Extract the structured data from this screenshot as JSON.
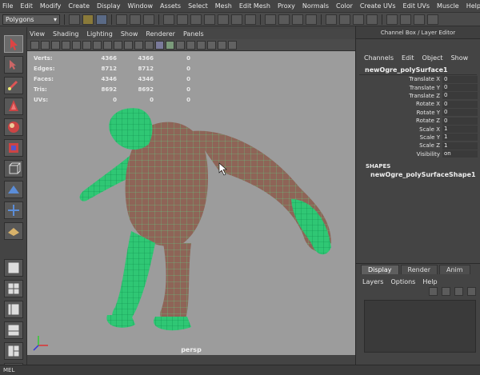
{
  "menubar": [
    "File",
    "Edit",
    "Modify",
    "Create",
    "Display",
    "Window",
    "Assets",
    "Select",
    "Mesh",
    "Edit Mesh",
    "Proxy",
    "Normals",
    "Color",
    "Create UVs",
    "Edit UVs",
    "Muscle",
    "Help"
  ],
  "mode_selector": {
    "value": "Polygons"
  },
  "viewport": {
    "menu": [
      "View",
      "Shading",
      "Lighting",
      "Show",
      "Renderer",
      "Panels"
    ],
    "camera": "persp",
    "stats": [
      {
        "label": "Verts:",
        "v1": "4366",
        "v2": "4366",
        "v3": "0"
      },
      {
        "label": "Edges:",
        "v1": "8712",
        "v2": "8712",
        "v3": "0"
      },
      {
        "label": "Faces:",
        "v1": "4346",
        "v2": "4346",
        "v3": "0"
      },
      {
        "label": "Tris:",
        "v1": "8692",
        "v2": "8692",
        "v3": "0"
      },
      {
        "label": "UVs:",
        "v1": "0",
        "v2": "0",
        "v3": "0"
      }
    ],
    "mesh_color": "#57e08a",
    "skin_color": "#8e6457",
    "background": "#9c9c9c"
  },
  "channel_box": {
    "title": "Channel Box / Layer Editor",
    "menu": [
      "Channels",
      "Edit",
      "Object",
      "Show"
    ],
    "object": "newOgre_polySurface1",
    "attributes": [
      {
        "name": "Translate X",
        "value": "0"
      },
      {
        "name": "Translate Y",
        "value": "0"
      },
      {
        "name": "Translate Z",
        "value": "0"
      },
      {
        "name": "Rotate X",
        "value": "0"
      },
      {
        "name": "Rotate Y",
        "value": "0"
      },
      {
        "name": "Rotate Z",
        "value": "0"
      },
      {
        "name": "Scale X",
        "value": "1"
      },
      {
        "name": "Scale Y",
        "value": "1"
      },
      {
        "name": "Scale Z",
        "value": "1"
      },
      {
        "name": "Visibility",
        "value": "on"
      }
    ],
    "shapes_header": "SHAPES",
    "shape": "newOgre_polySurfaceShape1"
  },
  "layer_editor": {
    "tabs": [
      "Display",
      "Render",
      "Anim"
    ],
    "menu": [
      "Layers",
      "Options",
      "Help"
    ]
  },
  "statusbar": {
    "text": "MEL"
  }
}
